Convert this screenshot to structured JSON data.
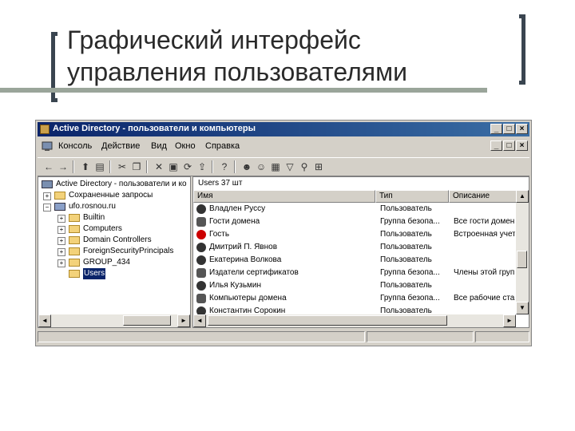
{
  "slide": {
    "title_line1": "Графический интерфейс",
    "title_line2": "управления пользователями"
  },
  "window": {
    "title": "Active Directory - пользователи и компьютеры",
    "btn_min": "_",
    "btn_max": "□",
    "btn_close": "×"
  },
  "menu": {
    "items": [
      "Консоль",
      "Действие",
      "Вид",
      "Окно",
      "Справка"
    ]
  },
  "tree": {
    "items": [
      {
        "label": "Active Directory - пользователи и ко",
        "expander": ""
      },
      {
        "label": "Сохраненные запросы",
        "expander": "+"
      },
      {
        "label": "ufo.rosnou.ru",
        "expander": "−"
      },
      {
        "label": "Builtin",
        "expander": "+"
      },
      {
        "label": "Computers",
        "expander": "+"
      },
      {
        "label": "Domain Controllers",
        "expander": "+"
      },
      {
        "label": "ForeignSecurityPrincipals",
        "expander": "+"
      },
      {
        "label": "GROUP_434",
        "expander": "+"
      },
      {
        "label": "Users",
        "expander": ""
      }
    ]
  },
  "list": {
    "header": "Users   37 шт",
    "columns": [
      "Имя",
      "Тип",
      "Описание"
    ],
    "rows": [
      {
        "name": "Владлен Руссу",
        "type": "Пользователь",
        "desc": "",
        "icon": "user"
      },
      {
        "name": "Гости домена",
        "type": "Группа безопа...",
        "desc": "Все гости домен",
        "icon": "group"
      },
      {
        "name": "Гость",
        "type": "Пользователь",
        "desc": "Встроенная учет",
        "icon": "disabled"
      },
      {
        "name": "Дмитрий П. Явнов",
        "type": "Пользователь",
        "desc": "",
        "icon": "user"
      },
      {
        "name": "Екатерина Волкова",
        "type": "Пользователь",
        "desc": "",
        "icon": "user"
      },
      {
        "name": "Издатели сертификатов",
        "type": "Группа безопа...",
        "desc": "Члены этой груп",
        "icon": "group"
      },
      {
        "name": "Илья Кузьмин",
        "type": "Пользователь",
        "desc": "",
        "icon": "user"
      },
      {
        "name": "Компьютеры домена",
        "type": "Группа безопа...",
        "desc": "Все рабочие ста",
        "icon": "group"
      },
      {
        "name": "Константин Сорокин",
        "type": "Пользователь",
        "desc": "",
        "icon": "user"
      }
    ]
  },
  "scroll": {
    "up": "▲",
    "down": "▼",
    "left": "◄",
    "right": "►"
  }
}
